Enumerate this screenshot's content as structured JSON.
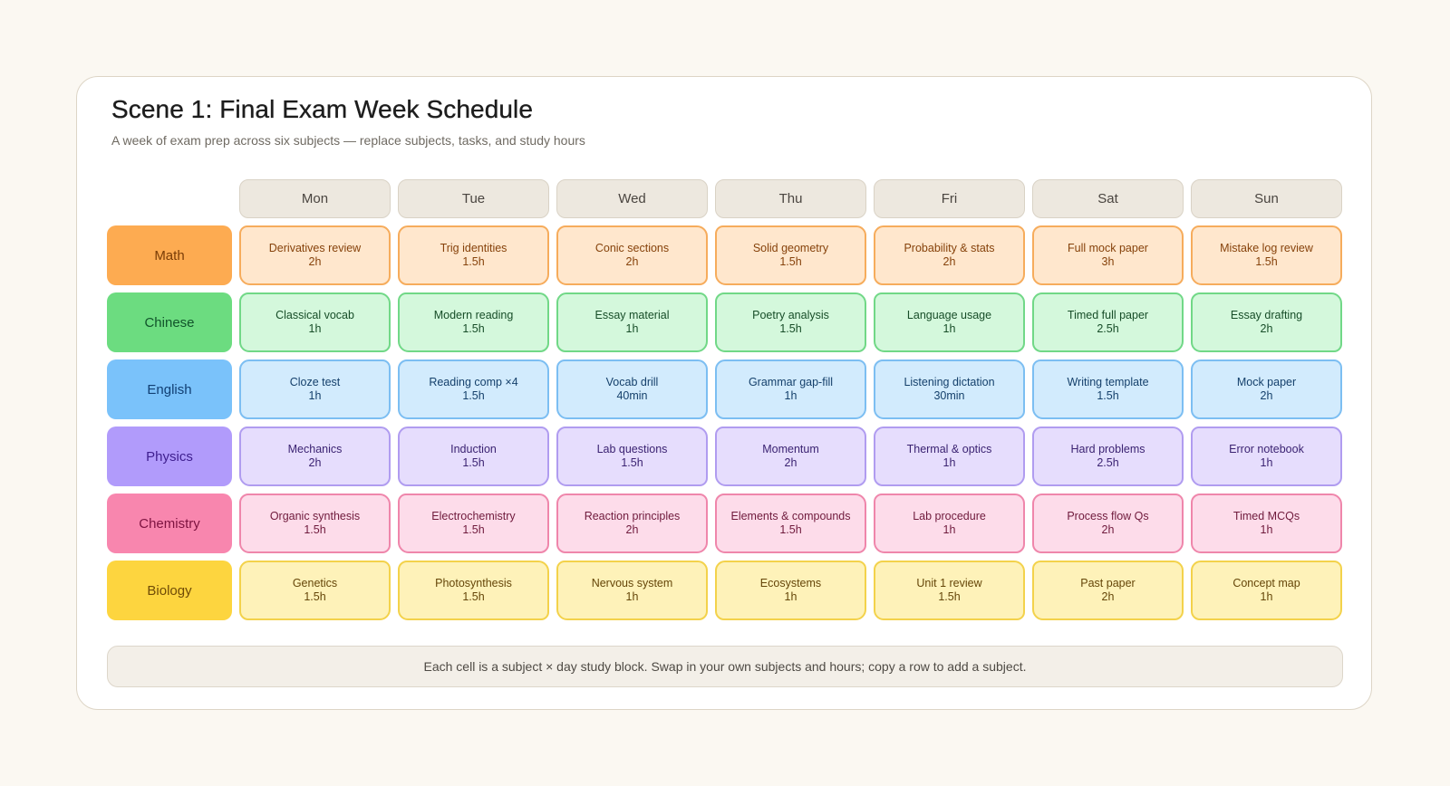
{
  "header": {
    "title": "Scene 1: Final Exam Week Schedule",
    "subtitle": "A week of exam prep across six subjects — replace subjects, tasks, and study hours"
  },
  "days": [
    "Mon",
    "Tue",
    "Wed",
    "Thu",
    "Fri",
    "Sat",
    "Sun"
  ],
  "subjects": [
    {
      "name": "Math",
      "colors": {
        "label_bg": "#fdab51",
        "label_text": "#7a3d07",
        "cell_bg": "#ffe7cd",
        "cell_border": "#f6ac5c",
        "cell_text": "#86420b"
      },
      "cells": [
        {
          "task": "Derivatives review",
          "hours": "2h"
        },
        {
          "task": "Trig identities",
          "hours": "1.5h"
        },
        {
          "task": "Conic sections",
          "hours": "2h"
        },
        {
          "task": "Solid geometry",
          "hours": "1.5h"
        },
        {
          "task": "Probability & stats",
          "hours": "2h"
        },
        {
          "task": "Full mock paper",
          "hours": "3h"
        },
        {
          "task": "Mistake log review",
          "hours": "1.5h"
        }
      ]
    },
    {
      "name": "Chinese",
      "colors": {
        "label_bg": "#6cdc80",
        "label_text": "#11532a",
        "cell_bg": "#d4f8dc",
        "cell_border": "#71d887",
        "cell_text": "#174d28"
      },
      "cells": [
        {
          "task": "Classical vocab",
          "hours": "1h"
        },
        {
          "task": "Modern reading",
          "hours": "1.5h"
        },
        {
          "task": "Essay material",
          "hours": "1h"
        },
        {
          "task": "Poetry analysis",
          "hours": "1.5h"
        },
        {
          "task": "Language usage",
          "hours": "1h"
        },
        {
          "task": "Timed full paper",
          "hours": "2.5h"
        },
        {
          "task": "Essay drafting",
          "hours": "2h"
        }
      ]
    },
    {
      "name": "English",
      "colors": {
        "label_bg": "#7ac2fa",
        "label_text": "#113f73",
        "cell_bg": "#d2ebfd",
        "cell_border": "#7cbef2",
        "cell_text": "#15406b"
      },
      "cells": [
        {
          "task": "Cloze test",
          "hours": "1h"
        },
        {
          "task": "Reading comp ×4",
          "hours": "1.5h"
        },
        {
          "task": "Vocab drill",
          "hours": "40min"
        },
        {
          "task": "Grammar gap-fill",
          "hours": "1h"
        },
        {
          "task": "Listening dictation",
          "hours": "30min"
        },
        {
          "task": "Writing template",
          "hours": "1.5h"
        },
        {
          "task": "Mock paper",
          "hours": "2h"
        }
      ]
    },
    {
      "name": "Physics",
      "colors": {
        "label_bg": "#b19bfb",
        "label_text": "#3e1e8e",
        "cell_bg": "#e6ddfd",
        "cell_border": "#b09cf0",
        "cell_text": "#3b2372"
      },
      "cells": [
        {
          "task": "Mechanics",
          "hours": "2h"
        },
        {
          "task": "Induction",
          "hours": "1.5h"
        },
        {
          "task": "Lab questions",
          "hours": "1.5h"
        },
        {
          "task": "Momentum",
          "hours": "2h"
        },
        {
          "task": "Thermal & optics",
          "hours": "1h"
        },
        {
          "task": "Hard problems",
          "hours": "2.5h"
        },
        {
          "task": "Error notebook",
          "hours": "1h"
        }
      ]
    },
    {
      "name": "Chemistry",
      "colors": {
        "label_bg": "#f886ae",
        "label_text": "#7d1340",
        "cell_bg": "#fddcea",
        "cell_border": "#ef86ab",
        "cell_text": "#6f1a3c"
      },
      "cells": [
        {
          "task": "Organic synthesis",
          "hours": "1.5h"
        },
        {
          "task": "Electrochemistry",
          "hours": "1.5h"
        },
        {
          "task": "Reaction principles",
          "hours": "2h"
        },
        {
          "task": "Elements & compounds",
          "hours": "1.5h"
        },
        {
          "task": "Lab procedure",
          "hours": "1h"
        },
        {
          "task": "Process flow Qs",
          "hours": "2h"
        },
        {
          "task": "Timed MCQs",
          "hours": "1h"
        }
      ]
    },
    {
      "name": "Biology",
      "colors": {
        "label_bg": "#fdd53f",
        "label_text": "#6f4b06",
        "cell_bg": "#fef2b9",
        "cell_border": "#f3d24b",
        "cell_text": "#654609"
      },
      "cells": [
        {
          "task": "Genetics",
          "hours": "1.5h"
        },
        {
          "task": "Photosynthesis",
          "hours": "1.5h"
        },
        {
          "task": "Nervous system",
          "hours": "1h"
        },
        {
          "task": "Ecosystems",
          "hours": "1h"
        },
        {
          "task": "Unit 1 review",
          "hours": "1.5h"
        },
        {
          "task": "Past paper",
          "hours": "2h"
        },
        {
          "task": "Concept map",
          "hours": "1h"
        }
      ]
    }
  ],
  "footer": {
    "note": "Each cell is a subject × day study block. Swap in your own subjects and hours; copy a row to add a subject."
  }
}
